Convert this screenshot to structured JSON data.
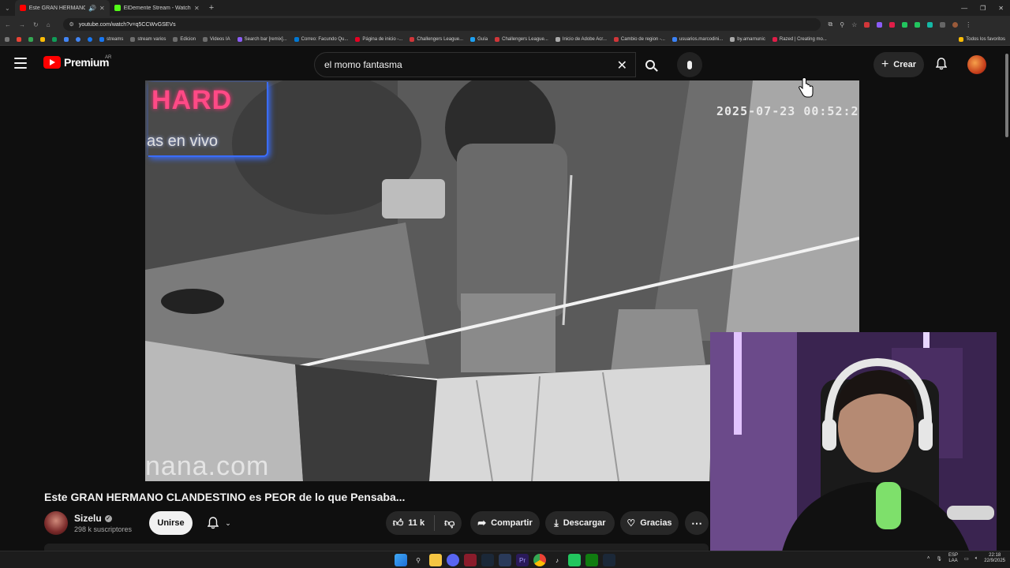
{
  "browser": {
    "tabs": [
      {
        "title": "Este GRAN HERMANO CL...",
        "active": true,
        "favicon_color": "#ff0000"
      },
      {
        "title": "ElDemente Stream - Watch Live...",
        "active": false,
        "favicon_color": "#53fc18"
      }
    ],
    "url": "youtube.com/watch?v=q5CCWvGSEVs",
    "bookmarks": [
      {
        "label": "streams",
        "color": "#1877f2"
      },
      {
        "label": "stream varios",
        "color": "#6d6d6d"
      },
      {
        "label": "Edicion",
        "color": "#6d6d6d"
      },
      {
        "label": "Videos IA",
        "color": "#6d6d6d"
      },
      {
        "label": "Search bar [remix]...",
        "color": "#8b5cf6"
      },
      {
        "label": "Correo: Facundo Qu...",
        "color": "#0078d4"
      },
      {
        "label": "Página de inicio -...",
        "color": "#e60023"
      },
      {
        "label": "Challengers League...",
        "color": "#d13639"
      },
      {
        "label": "Guía",
        "color": "#1da1f2"
      },
      {
        "label": "Challengers League...",
        "color": "#d13639"
      },
      {
        "label": "Inicio de Adobe Acr...",
        "color": "#aaaaaa"
      },
      {
        "label": "Cambio de region -...",
        "color": "#d13639"
      },
      {
        "label": "usuarios.marcodini...",
        "color": "#3b82f6"
      },
      {
        "label": "by.amarnunic",
        "color": "#aaaaaa"
      },
      {
        "label": "Razed | Creating mo...",
        "color": "#e11d48"
      }
    ],
    "bookmarks_right": "Todos los favoritos"
  },
  "masthead": {
    "logo_text": "Premium",
    "region": "AR",
    "search_value": "el momo fantasma",
    "create_label": "Crear"
  },
  "video": {
    "overlay_timestamp": "2025-07-23 00:52:2",
    "neon_sign": "HARD",
    "neon_sub": "as en vivo",
    "watermark": "nana.com",
    "title": "Este GRAN HERMANO CLANDESTINO es PEOR de lo que Pensaba..."
  },
  "channel": {
    "name": "Sizelu",
    "subscribers": "298 k suscriptores",
    "join_label": "Unirse"
  },
  "actions": {
    "likes": "11 k",
    "share_label": "Compartir",
    "download_label": "Descargar",
    "thanks_label": "Gracias"
  },
  "taskbar": {
    "lang": "ESP",
    "lang_sub": "LAA",
    "time": "22:18",
    "date": "22/9/2025"
  }
}
